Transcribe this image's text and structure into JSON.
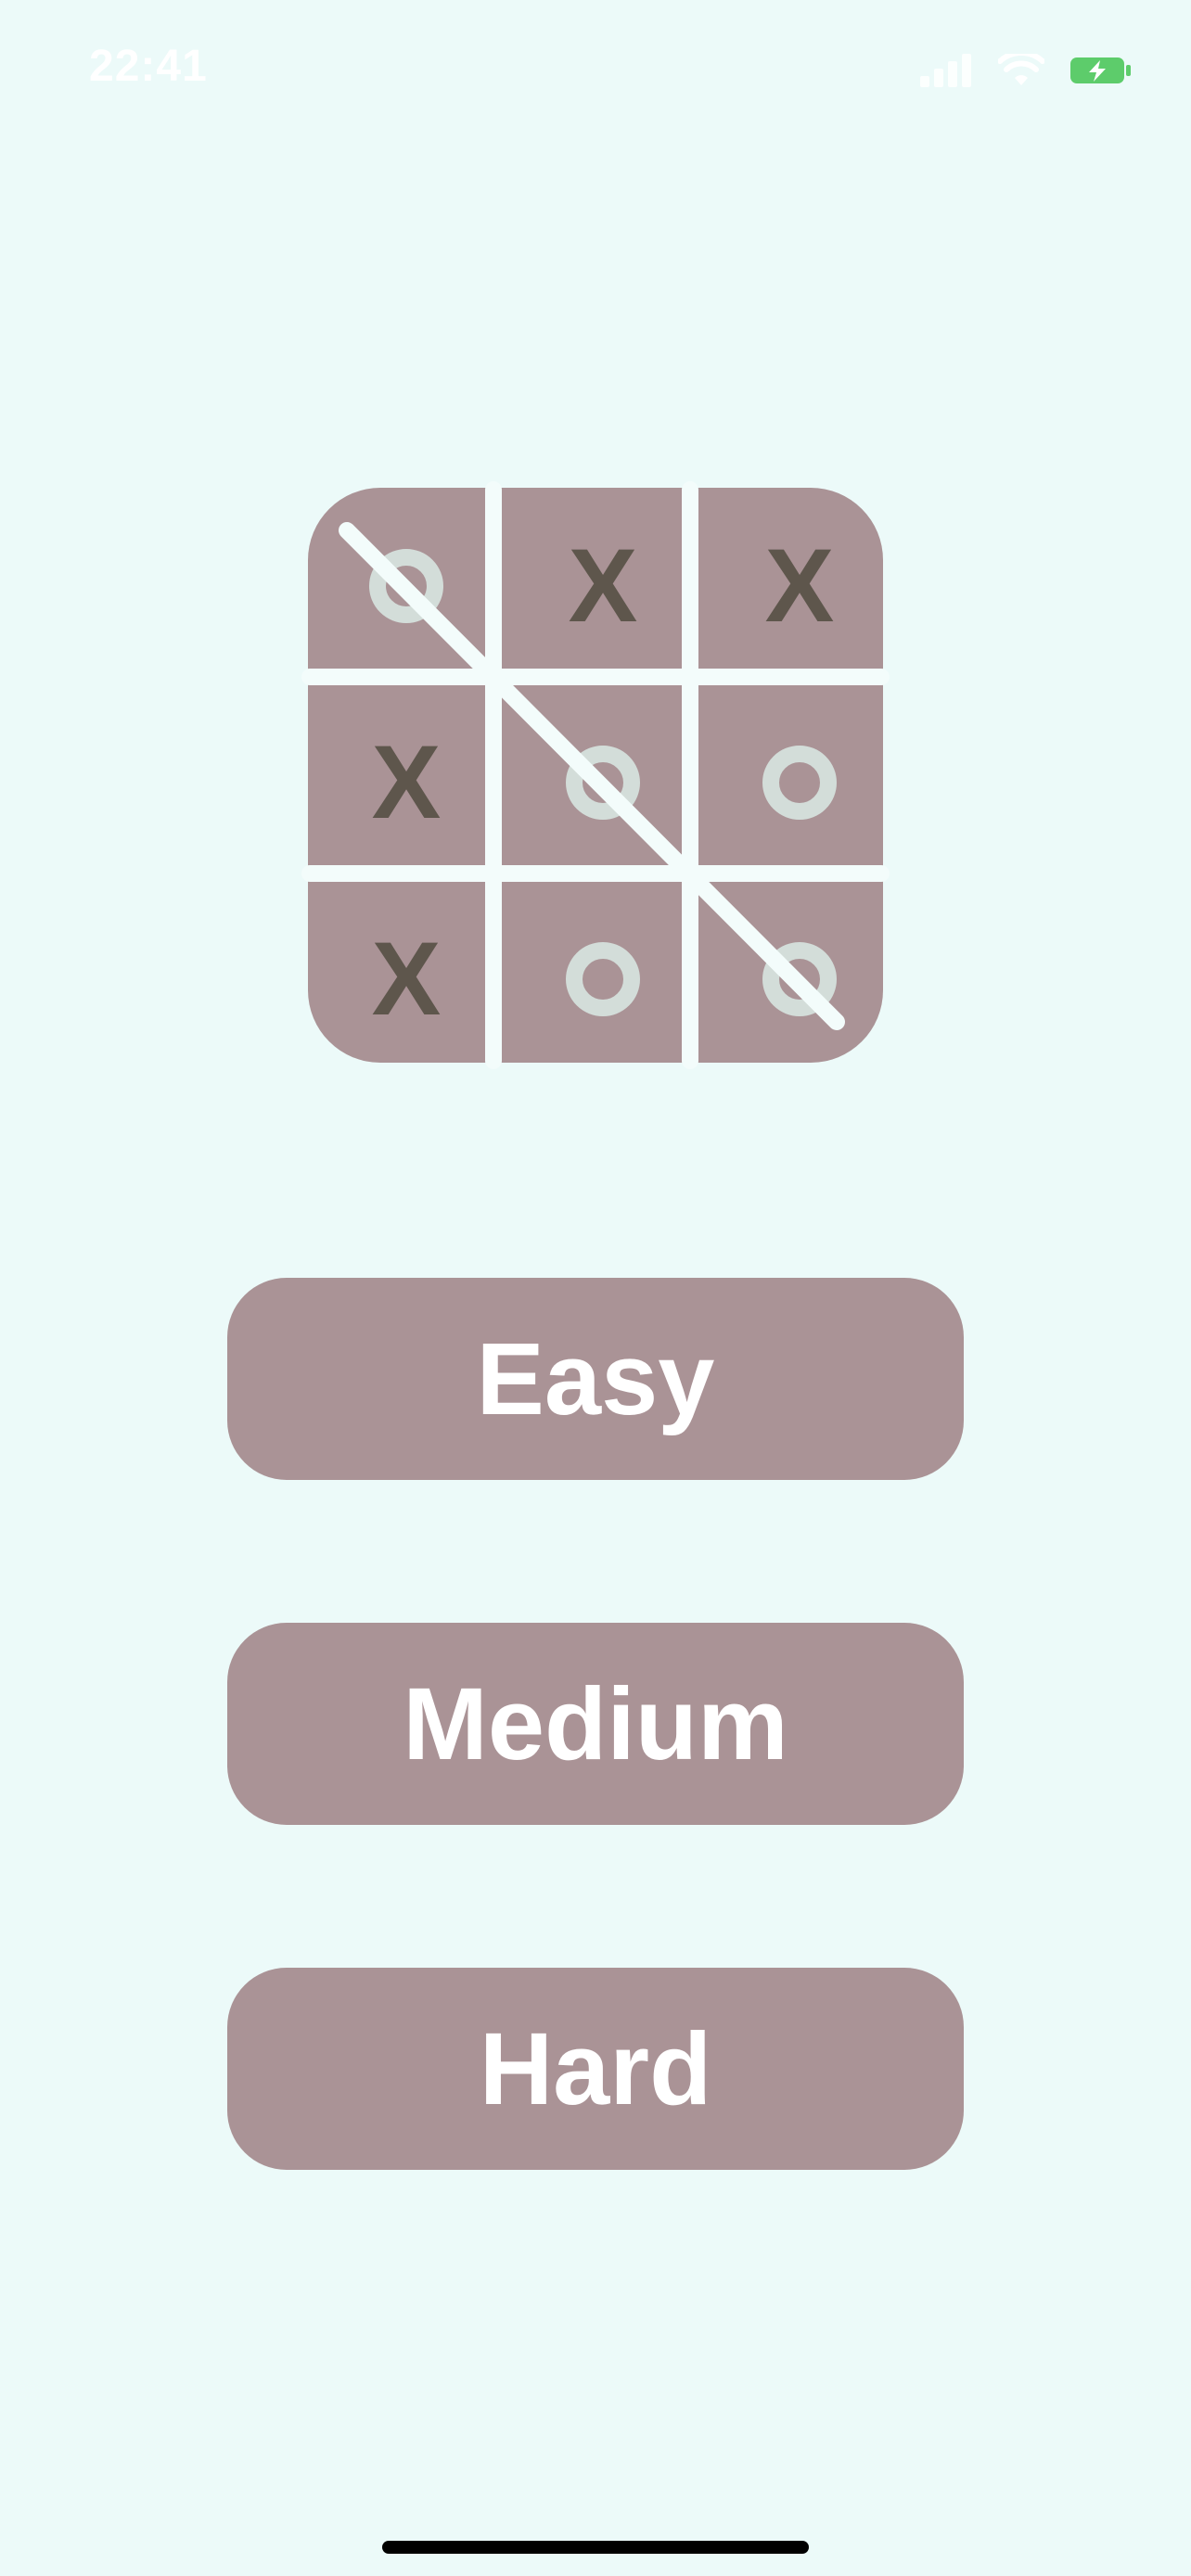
{
  "status_bar": {
    "time": "22:41"
  },
  "board": {
    "cells": [
      [
        "O",
        "X",
        "X"
      ],
      [
        "X",
        "O",
        "O"
      ],
      [
        "X",
        "O",
        "O"
      ]
    ],
    "winning_line": "diagonal-top-left-to-bottom-right"
  },
  "buttons": {
    "easy": "Easy",
    "medium": "Medium",
    "hard": "Hard"
  },
  "colors": {
    "background": "#ecfaf9",
    "board": "#aa9396",
    "x_mark": "#5e564c",
    "o_mark": "#d3ddd9",
    "button": "#aa9396",
    "battery": "#5dcc6b"
  }
}
